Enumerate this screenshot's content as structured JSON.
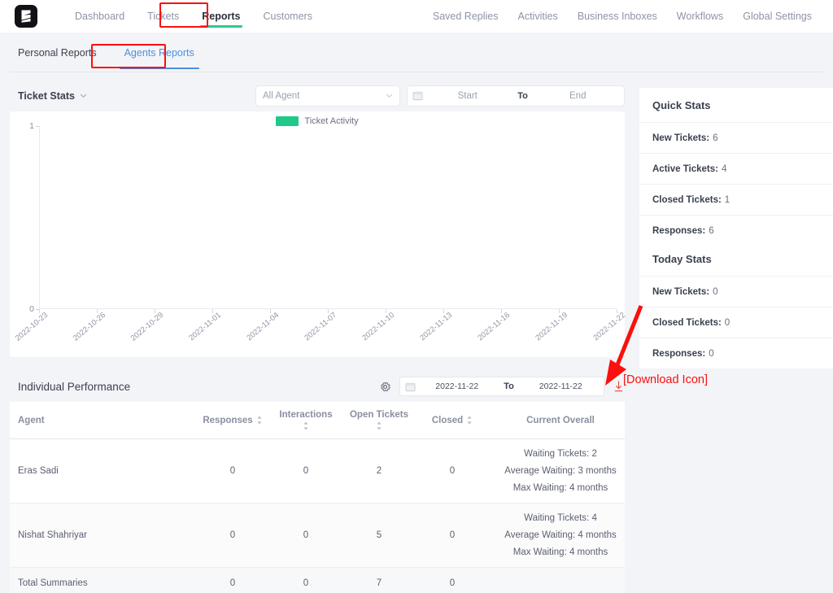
{
  "app": {
    "logo_name": "fluent-support-logo"
  },
  "topnav": {
    "left_items": [
      {
        "label": "Dashboard",
        "active": false
      },
      {
        "label": "Tickets",
        "active": false
      },
      {
        "label": "Reports",
        "active": true
      },
      {
        "label": "Customers",
        "active": false
      }
    ],
    "right_items": [
      {
        "label": "Saved Replies"
      },
      {
        "label": "Activities"
      },
      {
        "label": "Business Inboxes"
      },
      {
        "label": "Workflows"
      },
      {
        "label": "Global Settings"
      }
    ]
  },
  "subtabs": [
    {
      "label": "Personal Reports",
      "active": false
    },
    {
      "label": "Agents Reports",
      "active": true
    }
  ],
  "ticket_stats": {
    "title": "Ticket Stats",
    "agent_filter_value": "All Agent",
    "date_start_placeholder": "Start",
    "date_to_label": "To",
    "date_end_placeholder": "End"
  },
  "chart_data": {
    "type": "line",
    "title": "",
    "xlabel": "",
    "ylabel": "",
    "legend": [
      {
        "name": "Ticket Activity",
        "color": "#1ec98a"
      }
    ],
    "legend_position": "top-center",
    "grid": false,
    "ylim": [
      0,
      1
    ],
    "yticks": [
      "0",
      "1"
    ],
    "categories": [
      "2022-10-23",
      "2022-10-26",
      "2022-10-29",
      "2022-11-01",
      "2022-11-04",
      "2022-11-07",
      "2022-11-10",
      "2022-11-13",
      "2022-11-16",
      "2022-11-19",
      "2022-11-22"
    ],
    "series": [
      {
        "name": "Ticket Activity",
        "values": [
          0,
          0,
          0,
          0,
          0,
          0,
          0,
          0,
          0,
          0,
          0
        ]
      }
    ]
  },
  "quick_stats": {
    "title": "Quick Stats",
    "rows": [
      {
        "label": "New Tickets:",
        "value": "6"
      },
      {
        "label": "Active Tickets:",
        "value": "4"
      },
      {
        "label": "Closed Tickets:",
        "value": "1"
      },
      {
        "label": "Responses:",
        "value": "6"
      }
    ]
  },
  "today_stats": {
    "title": "Today Stats",
    "rows": [
      {
        "label": "New Tickets:",
        "value": "0"
      },
      {
        "label": "Closed Tickets:",
        "value": "0"
      },
      {
        "label": "Responses:",
        "value": "0"
      }
    ]
  },
  "individual_performance": {
    "title": "Individual Performance",
    "date_start": "2022-11-22",
    "date_to_label": "To",
    "date_end": "2022-11-22",
    "columns": [
      "Agent",
      "Responses",
      "Interactions",
      "Open Tickets",
      "Closed",
      "Current Overall"
    ],
    "rows": [
      {
        "agent": "Eras Sadi",
        "responses": "0",
        "interactions": "0",
        "open_tickets": "2",
        "closed": "0",
        "overall": [
          "Waiting Tickets: 2",
          "Average Waiting: 3 months",
          "Max Waiting: 4 months"
        ]
      },
      {
        "agent": "Nishat Shahriyar",
        "responses": "0",
        "interactions": "0",
        "open_tickets": "5",
        "closed": "0",
        "overall": [
          "Waiting Tickets: 4",
          "Average Waiting: 4 months",
          "Max Waiting: 4 months"
        ]
      }
    ],
    "total_row": {
      "agent": "Total Summaries",
      "responses": "0",
      "interactions": "0",
      "open_tickets": "7",
      "closed": "0"
    }
  },
  "annotations": {
    "download_label": "[Download Icon]",
    "highlight_color": "#fb0f0f"
  },
  "colors": {
    "accent_green": "#2cc98e",
    "link_blue": "#4a90e2",
    "annotation_red": "#fb0f0f"
  }
}
